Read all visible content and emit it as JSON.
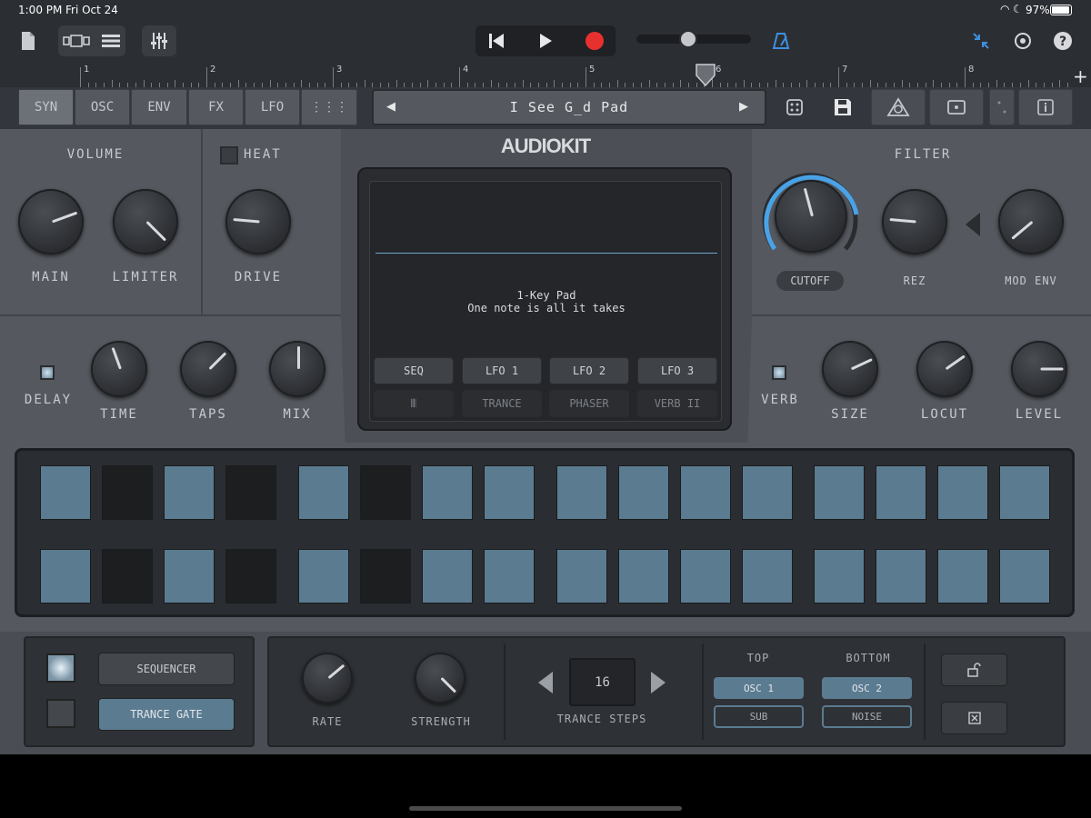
{
  "status": {
    "time": "1:00 PM",
    "date": "Fri Oct 24",
    "battery": "97%"
  },
  "icons": {
    "doc": "document-icon",
    "view": "view-toggle-icon",
    "mixer": "mixer-icon",
    "rewind": "skip-back-icon",
    "play": "play-icon",
    "record": "record-icon",
    "metronome": "metronome-icon",
    "collapse": "collapse-arrows-icon",
    "settings": "settings-icon",
    "help": "help-icon",
    "add": "plus-icon"
  },
  "ruler": {
    "marks": [
      "1",
      "2",
      "3",
      "4",
      "5",
      "6",
      "7",
      "8"
    ]
  },
  "transport": {
    "volume_level": 0.45
  },
  "tabs": [
    "SYN",
    "OSC",
    "ENV",
    "FX",
    "LFO",
    "⋮⋮⋮"
  ],
  "preset": {
    "name": "I See G_d Pad"
  },
  "brand": "AUDIOKIT",
  "volume": {
    "title": "VOLUME",
    "main": "MAIN",
    "limiter": "LIMITER"
  },
  "heat": {
    "title": "HEAT",
    "drive": "DRIVE"
  },
  "filter": {
    "title": "FILTER",
    "cutoff": "CUTOFF",
    "rez": "REZ",
    "mod_env": "MOD ENV"
  },
  "delay": {
    "title": "DELAY",
    "time": "TIME",
    "taps": "TAPS",
    "mix": "MIX"
  },
  "reverb": {
    "title": "VERB",
    "size": "SIZE",
    "locut": "LOCUT",
    "level": "LEVEL"
  },
  "screen": {
    "line1": "1-Key Pad",
    "line2": "One note is all it takes",
    "row1": [
      "SEQ",
      "LFO 1",
      "LFO 2",
      "LFO 3"
    ],
    "row2": [
      "𝄃𝄃",
      "TRANCE",
      "PHASER",
      "VERB II"
    ]
  },
  "sequencer": {
    "rows": [
      [
        1,
        0,
        1,
        0,
        1,
        0,
        1,
        1,
        1,
        1,
        1,
        1,
        1,
        1,
        1,
        1
      ],
      [
        1,
        0,
        1,
        0,
        1,
        0,
        1,
        1,
        1,
        1,
        1,
        1,
        1,
        1,
        1,
        1
      ]
    ]
  },
  "bottom": {
    "sequencer_label": "SEQUENCER",
    "trance_gate_label": "TRANCE GATE",
    "rate": "RATE",
    "strength": "STRENGTH",
    "steps_value": "16",
    "steps_label": "TRANCE STEPS",
    "top_label": "TOP",
    "bottom_label": "BOTTOM",
    "top_osc": "OSC 1",
    "top_sub": "SUB",
    "bottom_osc": "OSC 2",
    "bottom_noise": "NOISE"
  },
  "colors": {
    "accent": "#5b7b90",
    "record": "#e8312f",
    "cutoff_ring": "#4aa3e8"
  }
}
